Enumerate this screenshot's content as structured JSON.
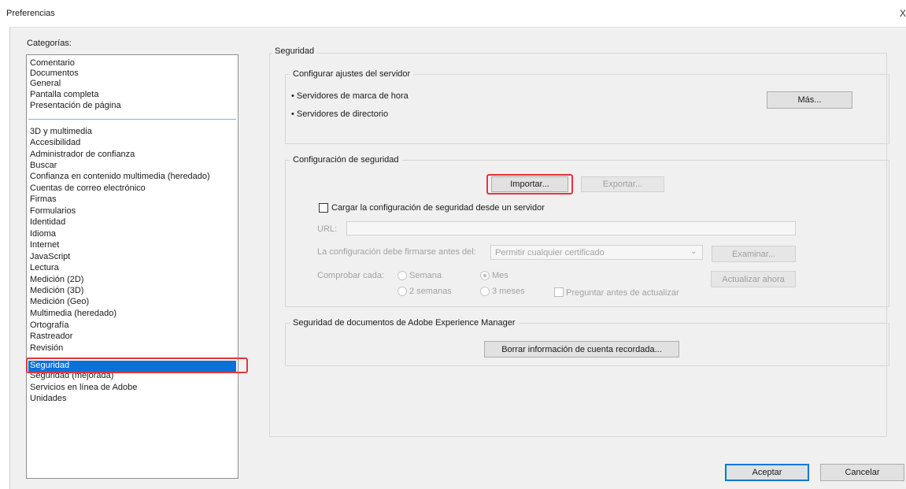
{
  "window": {
    "title": "Preferencias",
    "close_glyph": "X"
  },
  "categories": {
    "label": "Categorías:",
    "group1": [
      "Comentario",
      "Documentos",
      "General",
      "Pantalla completa",
      "Presentación de página"
    ],
    "group2": [
      "3D y multimedia",
      "Accesibilidad",
      "Administrador de confianza",
      "Buscar",
      "Confianza en contenido multimedia (heredado)",
      "Cuentas de correo electrónico",
      "Firmas",
      "Formularios",
      "Identidad",
      "Idioma",
      "Internet",
      "JavaScript",
      "Lectura",
      "Medición (2D)",
      "Medición (3D)",
      "Medición (Geo)",
      "Multimedia (heredado)",
      "Ortografía",
      "Rastreador",
      "Revisión",
      "Seguridad",
      "Seguridad (mejorada)",
      "Servicios en línea de Adobe",
      "Unidades"
    ],
    "selected": "Seguridad"
  },
  "panel": {
    "title": "Seguridad",
    "server": {
      "legend": "Configurar ajustes del servidor",
      "items": [
        "• Servidores de marca de hora",
        "• Servidores de directorio"
      ],
      "more_button": "Más..."
    },
    "security_settings": {
      "legend": "Configuración de seguridad",
      "import_button": "Importar...",
      "export_button": "Exportar...",
      "load_checkbox_label": "Cargar la configuración de seguridad desde un servidor",
      "url_label": "URL:",
      "url_value": "",
      "sign_label": "La configuración debe firmarse antes del:",
      "sign_select_value": "Permitir cualquier certificado",
      "browse_button": "Examinar...",
      "check_label": "Comprobar cada:",
      "options": [
        "Semana",
        "Mes",
        "2 semanas",
        "3 meses"
      ],
      "selected_option": "Mes",
      "ask_checkbox_label": "Preguntar antes de actualizar",
      "update_button": "Actualizar ahora"
    },
    "aem": {
      "legend": "Seguridad de documentos de Adobe Experience Manager",
      "clear_button": "Borrar información de cuenta recordada..."
    }
  },
  "footer": {
    "ok_button": "Aceptar",
    "cancel_button": "Cancelar"
  },
  "colors": {
    "selection": "#0b71d9",
    "highlight_box": "#e8333a",
    "dialog_bg": "#f0f0f0"
  },
  "icons": [
    "close-icon",
    "chevron-down-icon"
  ]
}
